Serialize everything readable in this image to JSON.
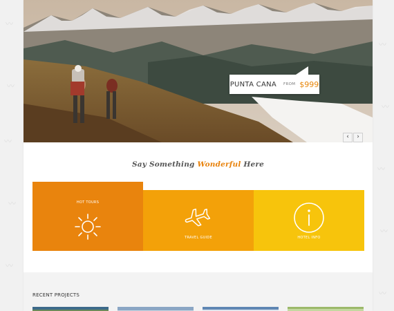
{
  "hero": {
    "destination": "PUNTA CANA",
    "from_label": "FROM",
    "price": "$999",
    "prev_arrow": "‹",
    "next_arrow": "›"
  },
  "headline": {
    "before": "Say Something ",
    "accent": "Wonderful",
    "after": " Here"
  },
  "tiles": [
    {
      "label": "HOT TOURS",
      "icon": "sun-icon",
      "color": "#e9840d"
    },
    {
      "label": "TRAVEL GUIDE",
      "icon": "airplane-icon",
      "color": "#f3a109"
    },
    {
      "label": "HOTEL INFO",
      "icon": "info-icon",
      "color": "#f7c40c"
    }
  ],
  "recent": {
    "title": "RECENT PROJECTS"
  },
  "colors": {
    "accent": "#e8860a",
    "background": "#f1f1f1"
  }
}
